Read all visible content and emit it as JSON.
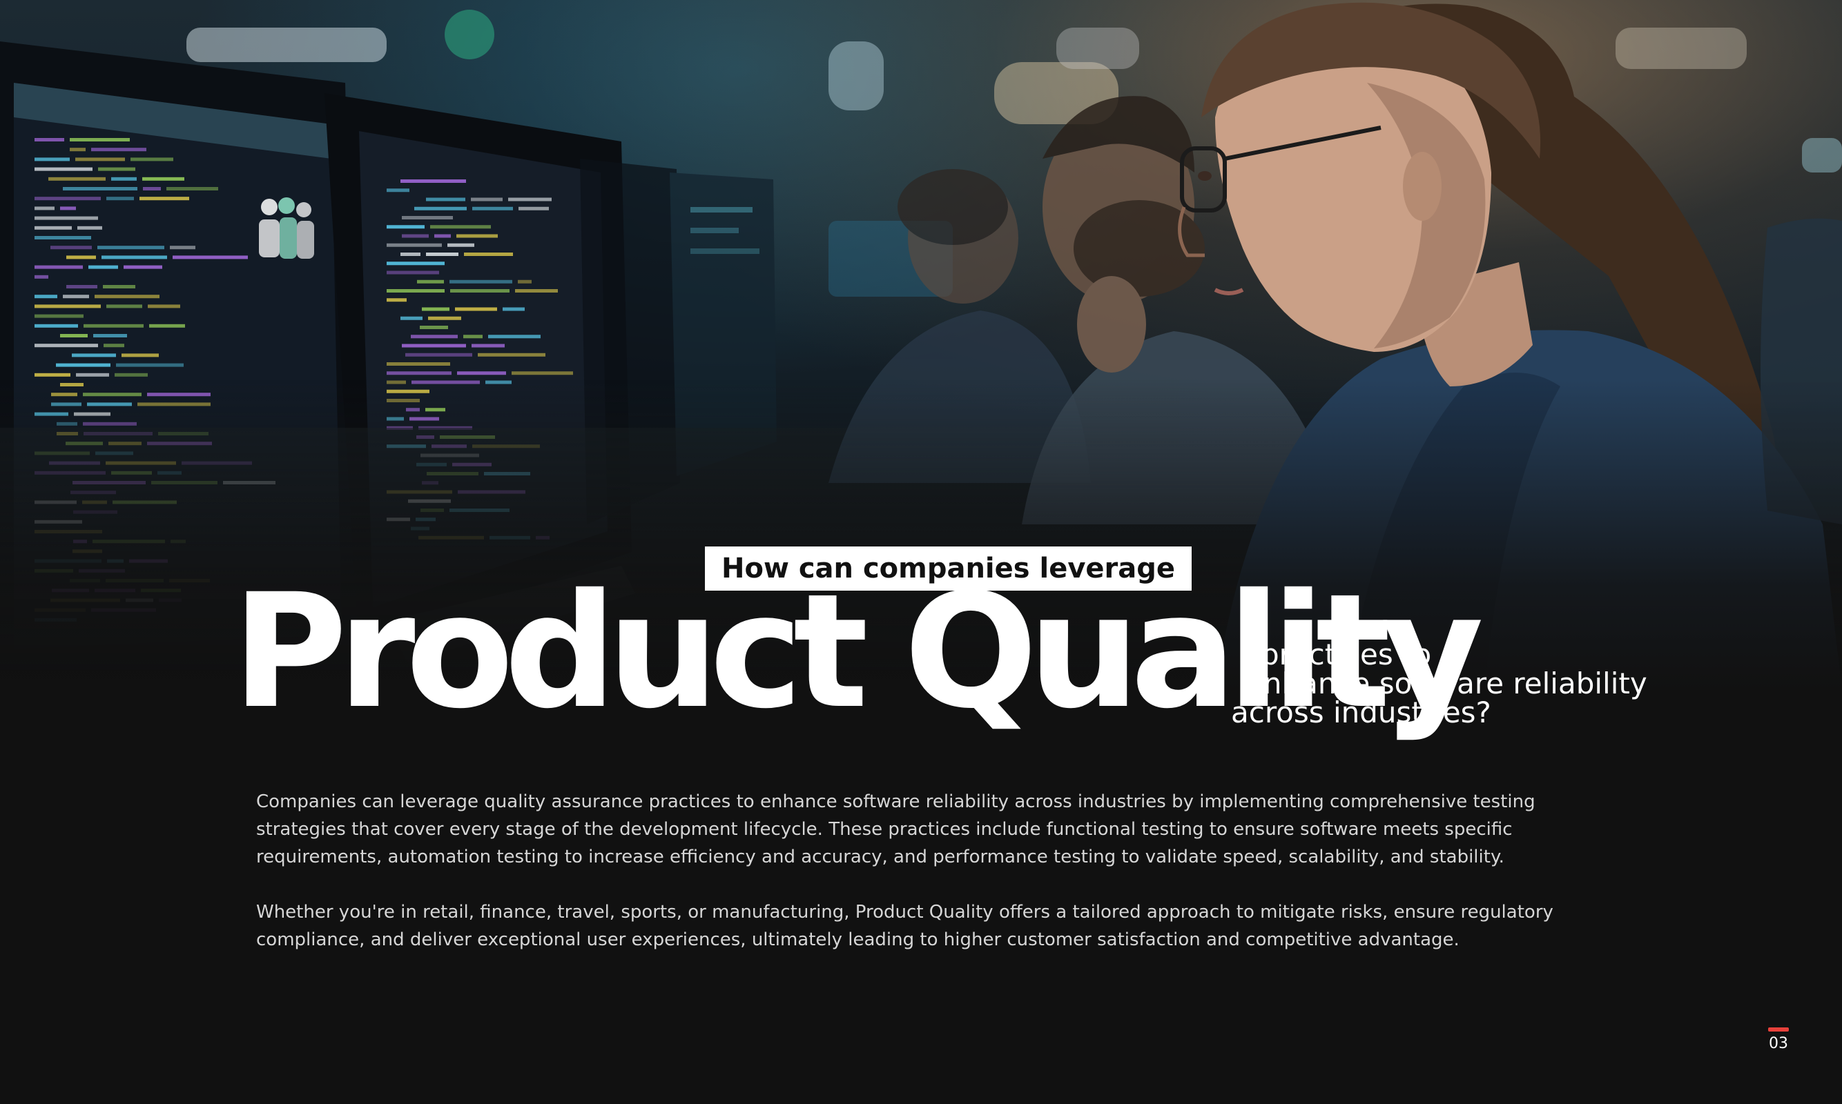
{
  "slide": {
    "kicker": "How can companies leverage",
    "headline": "Product Quality",
    "subline": [
      "practices to",
      "enhance software reliability",
      "across industries?"
    ],
    "paragraphs": [
      "Companies can leverage quality assurance practices to enhance software reliability across industries by implementing comprehensive testing strategies that cover every stage of the development lifecycle. These practices include functional testing to ensure software meets specific requirements, automation testing to increase efficiency and accuracy, and performance testing to validate speed, scalability, and stability.",
      "Whether you're in retail, finance, travel, sports, or manufacturing, Product Quality offers a tailored approach to mitigate risks, ensure regulatory compliance, and deliver exceptional user experiences, ultimately leading to higher customer satisfaction and competitive advantage."
    ],
    "page_number": "03"
  },
  "colors": {
    "background": "#111111",
    "text_primary": "#ffffff",
    "text_body": "#d6d6d6",
    "accent_red": "#e8413b",
    "code_cyan": "#58c7e8",
    "code_green": "#9ad45c",
    "code_yellow": "#d9c64a",
    "code_purple": "#a76be0"
  },
  "hero_image": {
    "subject": "developers working at monitors displaying code"
  }
}
